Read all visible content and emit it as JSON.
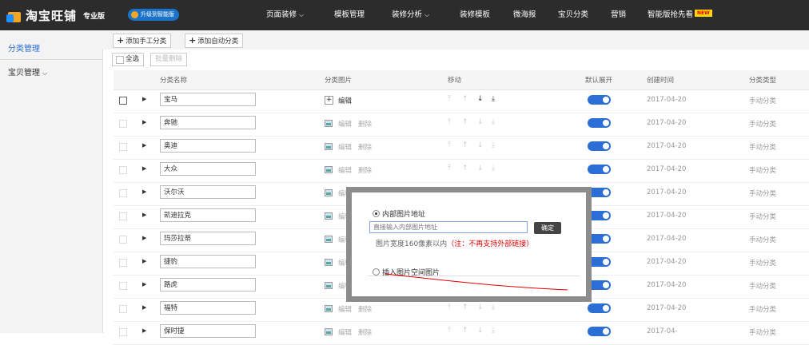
{
  "brand": {
    "name": "淘宝旺铺",
    "edition": "专业版",
    "upgrade": "升级到智能版"
  },
  "nav": [
    {
      "label": "页面装修",
      "dropdown": true
    },
    {
      "label": "模板管理",
      "dropdown": false
    },
    {
      "label": "装修分析",
      "dropdown": true
    },
    {
      "label": "装修模板",
      "dropdown": false
    },
    {
      "label": "微海报",
      "dropdown": false
    },
    {
      "label": "宝贝分类",
      "dropdown": false
    },
    {
      "label": "营销",
      "dropdown": false
    },
    {
      "label": "智能版抢先看",
      "dropdown": false,
      "badge": "NEW"
    }
  ],
  "sidebar": {
    "items": [
      {
        "label": "分类管理",
        "active": true
      },
      {
        "label": "宝贝管理",
        "dropdown": true
      }
    ]
  },
  "toolbar": {
    "add_manual": "添加手工分类",
    "add_auto": "添加自动分类",
    "select_all": "全选",
    "batch_delete": "批量删除"
  },
  "table": {
    "headers": [
      "分类名称",
      "分类图片",
      "移动",
      "默认展开",
      "创建时间",
      "分类类型"
    ],
    "rows": [
      {
        "name": "宝马",
        "date": "2017-04-20",
        "type": "手动分类"
      },
      {
        "name": "奔驰",
        "date": "2017-04-20",
        "type": "手动分类"
      },
      {
        "name": "奥迪",
        "date": "2017-04-20",
        "type": "手动分类"
      },
      {
        "name": "大众",
        "date": "2017-04-20",
        "type": "手动分类"
      },
      {
        "name": "沃尔沃",
        "date": "2017-04-20",
        "type": "手动分类"
      },
      {
        "name": "凯迪拉克",
        "date": "2017-04-20",
        "type": "手动分类"
      },
      {
        "name": "玛莎拉蒂",
        "date": "2017-04-20",
        "type": "手动分类"
      },
      {
        "name": "捷豹",
        "date": "2017-04-20",
        "type": "手动分类"
      },
      {
        "name": "路虎",
        "date": "2017-04-20",
        "type": "手动分类"
      },
      {
        "name": "福特",
        "date": "2017-04-20",
        "type": "手动分类"
      },
      {
        "name": "保时捷",
        "date": "2017-04-",
        "type": "手动分类"
      }
    ],
    "edit_label": "编辑",
    "delete_label": "删除"
  },
  "dialog": {
    "option1": "内部图片地址",
    "input_placeholder": "直接输入内部图片地址",
    "ok_label": "确定",
    "hint": "图片宽度160像素以内",
    "hint_warning": "（注：不再支持外部链接）",
    "option2": "插入图片空间图片"
  },
  "colors": {
    "topbar": "#2c2c2c",
    "accent": "#2b6fd6",
    "warning": "#e60000",
    "sidebar_bg": "#f3f3f3"
  }
}
